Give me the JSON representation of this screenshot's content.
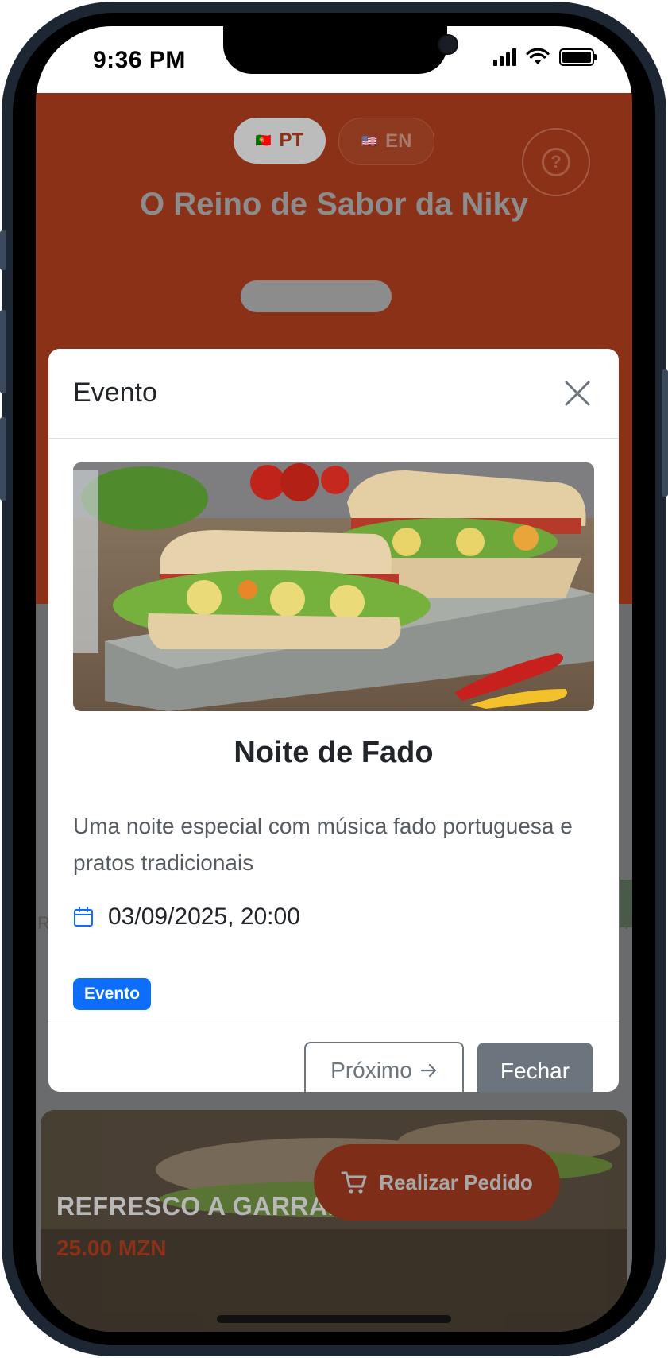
{
  "status_bar": {
    "time": "9:36 PM"
  },
  "header": {
    "languages": [
      {
        "flag": "🇵🇹",
        "code": "PT",
        "active": true
      },
      {
        "flag": "🇺🇸",
        "code": "EN",
        "active": false
      }
    ],
    "help_icon": "question-circle-icon",
    "restaurant_name": "O Reino de Sabor da Niky"
  },
  "background": {
    "product_title": "REFRESCO A GARRAFA",
    "product_price": "25.00 MZN",
    "side_left_letter": "R",
    "side_right_letter": "T",
    "order_button_label": "Realizar Pedido",
    "order_icon": "cart-icon"
  },
  "modal": {
    "title": "Evento",
    "close_icon": "close-icon",
    "image_icon": "sandwich-photo",
    "event_name": "Noite de Fado",
    "description": "Uma noite especial com música fado portuguesa e pratos tradicionais",
    "date_icon": "calendar-icon",
    "datetime": "03/09/2025, 20:00",
    "badge": "Evento",
    "next_button_label": "Próximo",
    "close_button_label": "Fechar"
  },
  "colors": {
    "brand": "#8a3118",
    "badge": "#0d6efd",
    "secondary": "#6c757d"
  }
}
